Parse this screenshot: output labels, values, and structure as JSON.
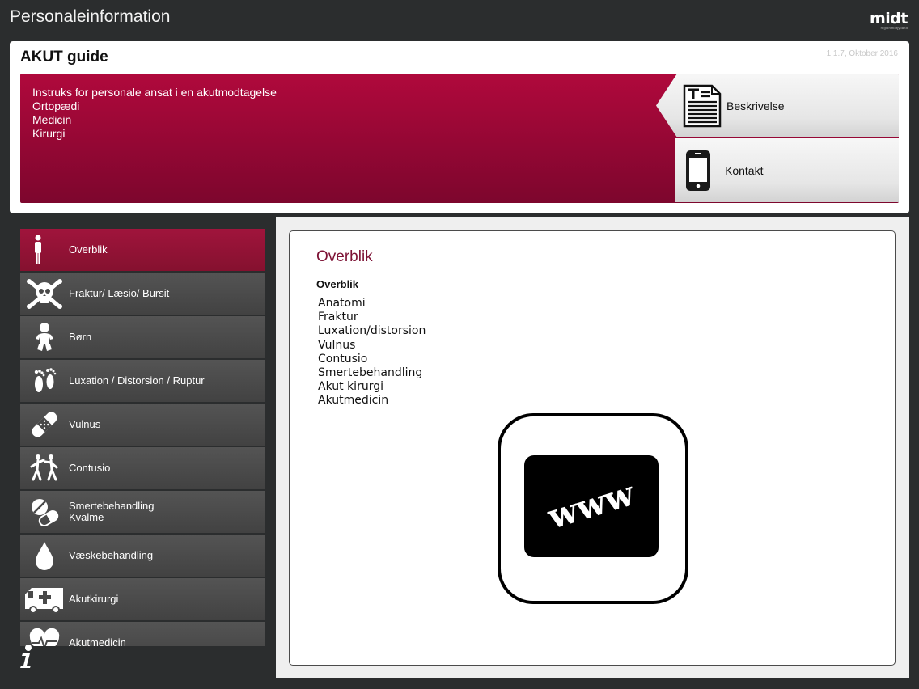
{
  "app": {
    "title": "Personaleinformation",
    "logo_text": "midt",
    "logo_subtext": "regionmidtjylland"
  },
  "header": {
    "guide_title": "AKUT guide",
    "version": "1.1.7, Oktober 2016",
    "banner_lines": [
      "Instruks for personale ansat i en akutmodtagelse",
      "Ortopædi",
      "Medicin",
      "Kirurgi"
    ],
    "description_button": {
      "label": "Beskrivelse",
      "icon": "document-icon"
    },
    "contact_button": {
      "label": "Kontakt",
      "icon": "phone-icon"
    }
  },
  "sidebar": {
    "items": [
      {
        "label": "Overblik",
        "label2": "",
        "icon": "person-icon",
        "active": true
      },
      {
        "label": "Fraktur/ Læsio/ Bursit",
        "label2": "",
        "icon": "skull-crossbones-icon",
        "active": false
      },
      {
        "label": "Børn",
        "label2": "",
        "icon": "baby-icon",
        "active": false
      },
      {
        "label": "Luxation / Distorsion / Ruptur",
        "label2": "",
        "icon": "footprints-icon",
        "active": false
      },
      {
        "label": "Vulnus",
        "label2": "",
        "icon": "bandage-icon",
        "active": false
      },
      {
        "label": "Contusio",
        "label2": "",
        "icon": "fighting-people-icon",
        "active": false
      },
      {
        "label": "Smertebehandling",
        "label2": "Kvalme",
        "icon": "pills-icon",
        "active": false
      },
      {
        "label": "Væskebehandling",
        "label2": "",
        "icon": "droplet-icon",
        "active": false
      },
      {
        "label": "Akutkirurgi",
        "label2": "",
        "icon": "ambulance-icon",
        "active": false
      },
      {
        "label": "Akutmedicin",
        "label2": "",
        "icon": "heart-pulse-icon",
        "active": false
      }
    ],
    "info_icon": "info-icon"
  },
  "content": {
    "title": "Overblik",
    "subtitle": "Overblik",
    "links": [
      "Anatomi",
      "Fraktur",
      "Luxation/distorsion",
      "Vulnus",
      "Contusio",
      "Smertebehandling",
      "Akut kirurgi",
      "Akutmedicin"
    ],
    "web_icon": {
      "icon": "www-icon",
      "text": "www"
    }
  },
  "colors": {
    "background": "#2b2d2e",
    "brand_red": "#940734",
    "active_nav": "#a0143c",
    "title_red": "#7d1235"
  }
}
